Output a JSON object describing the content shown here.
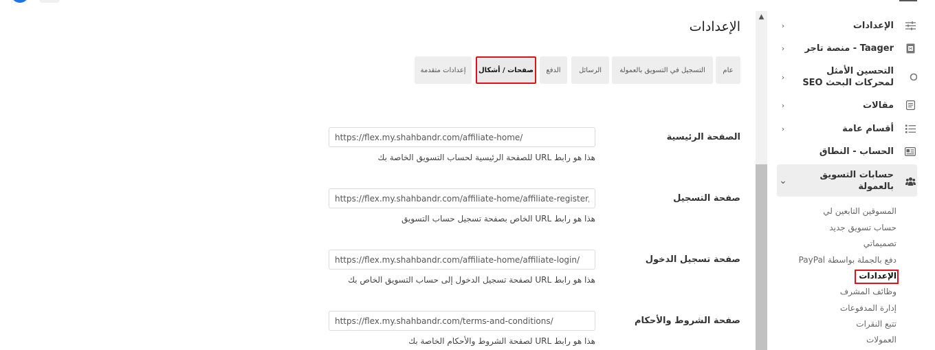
{
  "page": {
    "title": "الإعدادات"
  },
  "sidebar": {
    "items": [
      {
        "label": "الإعدادات",
        "icon": "sliders-icon",
        "chevron": "‹"
      },
      {
        "label": "Taager - منصة تاجر",
        "icon": "document-icon",
        "chevron": "‹"
      },
      {
        "label": "التحسين الأمثل لمحركات البحث SEO",
        "icon": "seo-icon",
        "chevron": "‹"
      },
      {
        "label": "مقالات",
        "icon": "article-icon",
        "chevron": "‹"
      },
      {
        "label": "أقسام عامة",
        "icon": "list-icon",
        "chevron": "‹"
      },
      {
        "label": "الحساب - النطاق",
        "icon": "id-card-icon",
        "chevron": ""
      },
      {
        "label": "حسابات التسويق بالعمولة",
        "icon": "users-icon",
        "chevron": "⌄"
      }
    ],
    "subitems": [
      "المسوقين التابعين لي",
      "حساب تسويق جديد",
      "تصميماتي",
      "دفع بالجملة بواسطة PayPal",
      "الإعدادات",
      "وظائف المشرف",
      "إدارة المدفوعات",
      "تتبع النقرات",
      "العمولات"
    ]
  },
  "tabs": [
    {
      "label": "عام"
    },
    {
      "label": "التسجيل في التسويق بالعمولة"
    },
    {
      "label": "الرسائل"
    },
    {
      "label": "الدفع"
    },
    {
      "label": "صفحات / أشكال"
    },
    {
      "label": "إعدادات متقدمة"
    }
  ],
  "fields": [
    {
      "label": "الصفحة الرئيسية",
      "value": "https://flex.my.shahbandr.com/affiliate-home/",
      "help": "هذا هو رابط URL للصفحة الرئيسية لحساب التسويق الخاصة بك"
    },
    {
      "label": "صفحة التسجيل",
      "value": "https://flex.my.shahbandr.com/affiliate-home/affiliate-register/",
      "help": "هذا هو رابط URL الخاص بصفحة تسجيل حساب التسويق"
    },
    {
      "label": "صفحة تسجيل الدخول",
      "value": "https://flex.my.shahbandr.com/affiliate-home/affiliate-login/",
      "help": "هذا هو رابط URL لصفحة تسجيل الدخول إلى حساب التسويق الخاص بك"
    },
    {
      "label": "صفحة الشروط والأحكام",
      "value": "https://flex.my.shahbandr.com/terms-and-conditions/",
      "help": "هذا هو رابط URL لصفحة الشروط والأحكام الخاصة بك"
    }
  ],
  "colors": {
    "highlight": "#e1101b",
    "tab_bg": "#eeeeee"
  }
}
